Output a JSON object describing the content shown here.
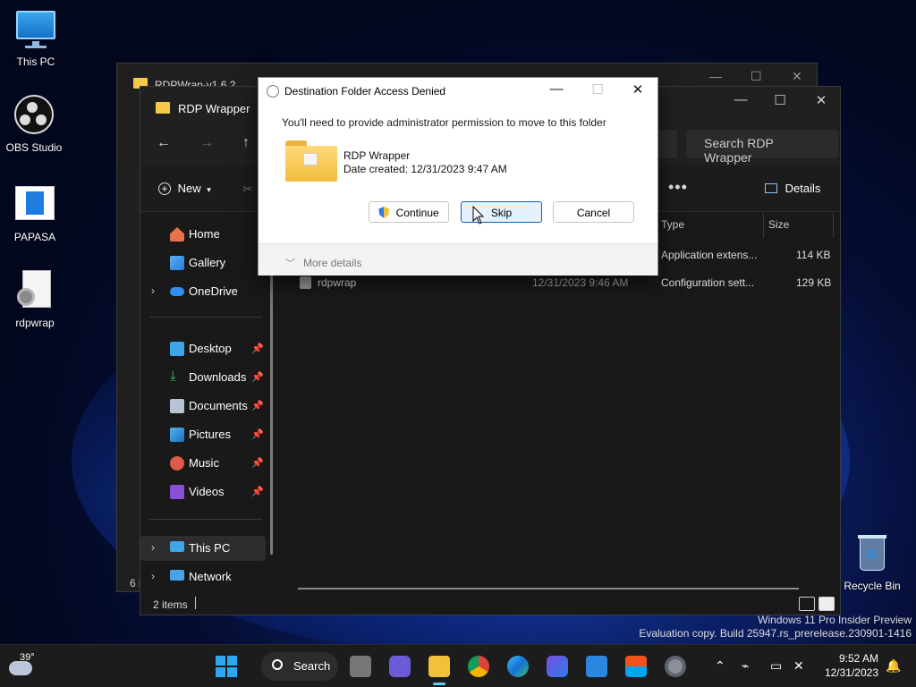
{
  "desktop": {
    "icons": [
      {
        "label": "This PC",
        "icon": "monitor-icon"
      },
      {
        "label": "OBS Studio",
        "icon": "obs-icon"
      },
      {
        "label": "PAPASA",
        "icon": "document-icon"
      },
      {
        "label": "rdpwrap",
        "icon": "settings-file-icon"
      },
      {
        "label": "Recycle Bin",
        "icon": "recycle-bin-icon"
      }
    ],
    "watermark_line1": "Windows 11 Pro Insider Preview",
    "watermark_line2": "Evaluation copy. Build 25947.rs_prerelease.230901-1416"
  },
  "back_window": {
    "title": "RDPWrap-v1.6.2",
    "status_count": "6 i"
  },
  "explorer": {
    "title": "RDP Wrapper",
    "search_placeholder": "Search RDP Wrapper",
    "toolbar": {
      "new_label": "New",
      "more_label": "•••",
      "details_label": "Details"
    },
    "sidebar": {
      "items": [
        {
          "label": "Home",
          "icon": "home-icon",
          "pinned": false
        },
        {
          "label": "Gallery",
          "icon": "gallery-icon",
          "pinned": false
        },
        {
          "label": "OneDrive",
          "icon": "onedrive-icon",
          "pinned": false
        },
        {
          "label": "Desktop",
          "icon": "desktop-icon",
          "pinned": true
        },
        {
          "label": "Downloads",
          "icon": "downloads-icon",
          "pinned": true
        },
        {
          "label": "Documents",
          "icon": "documents-icon",
          "pinned": true
        },
        {
          "label": "Pictures",
          "icon": "pictures-icon",
          "pinned": true
        },
        {
          "label": "Music",
          "icon": "music-icon",
          "pinned": true
        },
        {
          "label": "Videos",
          "icon": "videos-icon",
          "pinned": true
        },
        {
          "label": "This PC",
          "icon": "this-pc-icon",
          "pinned": false
        },
        {
          "label": "Network",
          "icon": "network-icon",
          "pinned": false
        }
      ]
    },
    "columns": {
      "type": "Type",
      "size": "Size"
    },
    "rows": [
      {
        "name": "",
        "date": "",
        "type": "Application extens...",
        "size": "114 KB"
      },
      {
        "name": "rdpwrap",
        "date": "12/31/2023 9:46 AM",
        "type": "Configuration sett...",
        "size": "129 KB"
      }
    ],
    "status": "2 items"
  },
  "dialog": {
    "title": "Destination Folder Access Denied",
    "message": "You'll need to provide administrator permission to move to this folder",
    "folder_name": "RDP Wrapper",
    "date_created": "Date created: 12/31/2023 9:47 AM",
    "buttons": {
      "continue": "Continue",
      "skip": "Skip",
      "cancel": "Cancel"
    },
    "more_details": "More details"
  },
  "taskbar": {
    "weather_temp": "39°",
    "search_label": "Search",
    "time": "9:52 AM",
    "date": "12/31/2023"
  },
  "colors": {
    "accent": "#0067c0",
    "taskbar_indicator": "#60cdff",
    "folder_yellow": "#f7c948"
  }
}
